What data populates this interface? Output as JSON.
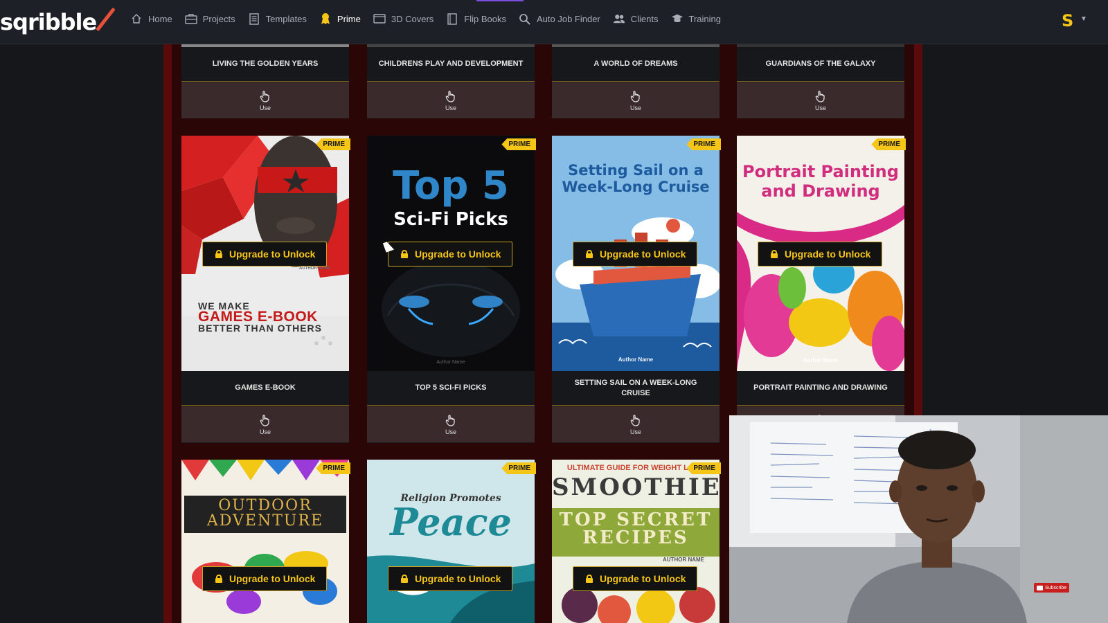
{
  "app": {
    "logo": "sqribble",
    "user_initial": "S"
  },
  "nav": {
    "items": [
      {
        "label": "Home",
        "icon": "home-icon"
      },
      {
        "label": "Projects",
        "icon": "projects-icon"
      },
      {
        "label": "Templates",
        "icon": "templates-icon"
      },
      {
        "label": "Prime",
        "icon": "prime-ribbon-icon",
        "active": true
      },
      {
        "label": "3D Covers",
        "icon": "3d-covers-icon"
      },
      {
        "label": "Flip Books",
        "icon": "flip-books-icon"
      },
      {
        "label": "Auto Job Finder",
        "icon": "search-icon"
      },
      {
        "label": "Clients",
        "icon": "clients-icon"
      },
      {
        "label": "Training",
        "icon": "training-icon"
      }
    ]
  },
  "colors": {
    "accent": "#f5c518",
    "panel_red": "#5a0a0a",
    "nav_bg": "#1d2026"
  },
  "labels": {
    "prime": "PRIME",
    "unlock": "Upgrade to Unlock",
    "use": "Use"
  },
  "rows": [
    {
      "cards": [
        {
          "title": "LIVING THE GOLDEN YEARS"
        },
        {
          "title": "CHILDRENS PLAY AND DEVELOPMENT"
        },
        {
          "title": "A WORLD OF DREAMS"
        },
        {
          "title": "GUARDIANS OF THE GALAXY"
        }
      ]
    },
    {
      "cards": [
        {
          "title": "GAMES E-BOOK",
          "cover_lines": [
            "WE MAKE",
            "GAMES E-BOOK",
            "BETTER THAN OTHERS"
          ],
          "cover_author": "AUTHOR NAME"
        },
        {
          "title": "TOP 5 SCI-FI PICKS",
          "cover_lines": [
            "Top 5",
            "Sci-Fi Picks"
          ],
          "cover_author": "Author Name"
        },
        {
          "title": "SETTING SAIL ON A WEEK-LONG CRUISE",
          "cover_lines": [
            "Setting Sail on a",
            "Week-Long Cruise"
          ],
          "cover_author": "Author Name"
        },
        {
          "title": "PORTRAIT PAINTING AND DRAWING",
          "cover_lines": [
            "Portrait Painting",
            "and Drawing"
          ],
          "cover_author": "Author Name"
        }
      ]
    },
    {
      "cards": [
        {
          "cover_lines": [
            "OUTDOOR",
            "ADVENTURE"
          ]
        },
        {
          "cover_lines": [
            "Religion Promotes",
            "Peace"
          ]
        },
        {
          "cover_lines": [
            "ULTIMATE GUIDE FOR WEIGHT LOSS",
            "SMOOTHIE",
            "TOP SECRET",
            "RECIPES"
          ],
          "cover_author": "AUTHOR NAME"
        }
      ]
    }
  ],
  "webcam": {
    "subscribe_label": "Subscribe"
  }
}
